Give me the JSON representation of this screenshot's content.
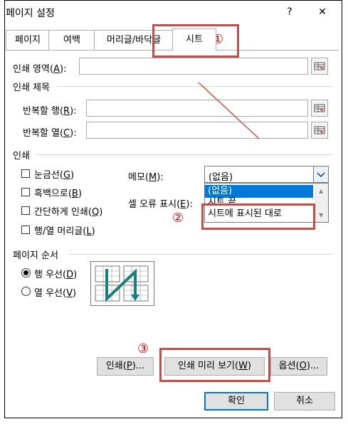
{
  "window": {
    "title": "페이지 설정",
    "help": "?",
    "close": "✕"
  },
  "tabs": [
    {
      "label": "페이지"
    },
    {
      "label": "여백"
    },
    {
      "label": "머리글/바닥글"
    },
    {
      "label": "시트"
    }
  ],
  "print_area": {
    "label": "인쇄 영역(",
    "key": "A",
    "suffix": "):",
    "value": ""
  },
  "print_titles": {
    "heading": "인쇄 제목",
    "rows": {
      "label": "반복할 행(",
      "key": "R",
      "suffix": "):",
      "value": ""
    },
    "cols": {
      "label": "반복할 열(",
      "key": "C",
      "suffix": "):",
      "value": ""
    }
  },
  "print": {
    "heading": "인쇄",
    "gridlines": {
      "label": "눈금선(",
      "key": "G",
      "suffix": ")",
      "checked": false
    },
    "bw": {
      "label": "흑백으로(",
      "key": "B",
      "suffix": ")",
      "checked": false
    },
    "draft": {
      "label": "간단하게 인쇄(",
      "key": "Q",
      "suffix": ")",
      "checked": false
    },
    "headings": {
      "label": "행/열 머리글(",
      "key": "L",
      "suffix": ")",
      "checked": false
    },
    "comments": {
      "label": "메모(",
      "key": "M",
      "suffix": "):",
      "value": "(없음)"
    },
    "errors": {
      "label": "셀 오류 표시(",
      "key": "E",
      "suffix": "):"
    },
    "dropdown": [
      "(없음)",
      "시트 끝",
      "시트에 표시된 대로"
    ]
  },
  "page_order": {
    "heading": "페이지 순서",
    "down_then_over": {
      "label": "행 우선(",
      "key": "D",
      "suffix": ")",
      "selected": true
    },
    "over_then_down": {
      "label": "열 우선(",
      "key": "V",
      "suffix": ")",
      "selected": false
    }
  },
  "buttons": {
    "print": {
      "label": "인쇄(",
      "key": "P",
      "suffix": ")..."
    },
    "preview": {
      "label": "인쇄 미리 보기(",
      "key": "W",
      "suffix": ")"
    },
    "options": {
      "label": "옵션(",
      "key": "O",
      "suffix": ")..."
    },
    "ok": "확인",
    "cancel": "취소"
  },
  "annotations": {
    "one": "①",
    "two": "②",
    "three": "③"
  },
  "colors": {
    "highlight": "#c0504d",
    "arrow": "#c0504d",
    "selection": "#0078d7"
  }
}
